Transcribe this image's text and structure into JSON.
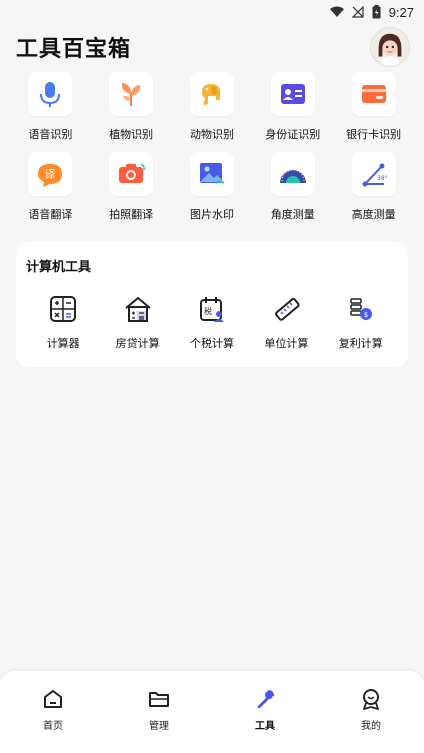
{
  "status_bar": {
    "time": "9:27"
  },
  "header": {
    "title": "工具百宝箱"
  },
  "tools": [
    {
      "label": "语音识别",
      "icon": "microphone-icon"
    },
    {
      "label": "植物识别",
      "icon": "plant-icon"
    },
    {
      "label": "动物识别",
      "icon": "elephant-icon"
    },
    {
      "label": "身份证识别",
      "icon": "id-card-icon"
    },
    {
      "label": "银行卡识别",
      "icon": "bank-card-icon"
    },
    {
      "label": "语音翻译",
      "icon": "translate-bubble-icon"
    },
    {
      "label": "拍照翻译",
      "icon": "camera-translate-icon"
    },
    {
      "label": "图片水印",
      "icon": "image-watermark-icon"
    },
    {
      "label": "角度测量",
      "icon": "protractor-icon"
    },
    {
      "label": "高度测量",
      "icon": "height-measure-icon"
    }
  ],
  "calculator_card": {
    "title": "计算机工具",
    "items": [
      {
        "label": "计算器",
        "icon": "calculator-icon"
      },
      {
        "label": "房贷计算",
        "icon": "house-calc-icon"
      },
      {
        "label": "个税计算",
        "icon": "tax-calendar-icon"
      },
      {
        "label": "单位计算",
        "icon": "ruler-icon"
      },
      {
        "label": "复利计算",
        "icon": "coins-icon"
      }
    ]
  },
  "bottom_nav": [
    {
      "label": "首页",
      "icon": "home-icon",
      "active": false
    },
    {
      "label": "管理",
      "icon": "folder-icon",
      "active": false
    },
    {
      "label": "工具",
      "icon": "wrench-icon",
      "active": true
    },
    {
      "label": "我的",
      "icon": "profile-icon",
      "active": false
    }
  ],
  "colors": {
    "accent": "#4a5ae8",
    "background": "#f6f6f6",
    "card": "#ffffff"
  }
}
